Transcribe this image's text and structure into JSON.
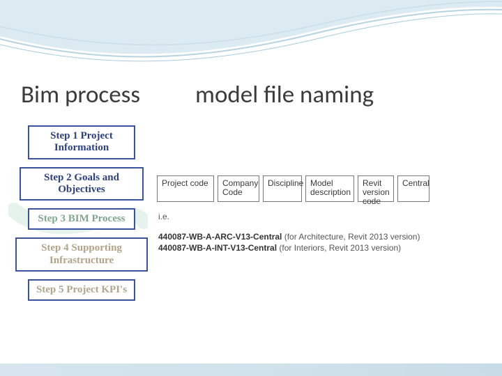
{
  "title_left": "Bim process",
  "title_right": "model file naming",
  "steps": [
    {
      "label": "Step 1 Project Information"
    },
    {
      "label": "Step 2 Goals and Objectives"
    },
    {
      "label": "Step 3 BIM Process"
    },
    {
      "label": "Step 4 Supporting Infrastructure"
    },
    {
      "label": "Step 5 Project KPI's"
    }
  ],
  "naming_parts": {
    "p0": "Project code",
    "p1": "Company Code",
    "p2": "Discipline",
    "p3": "Model description",
    "p4": "Revit version code",
    "p5": "Central"
  },
  "ie_label": "i.e.",
  "examples": {
    "line1_code": "440087-WB-A-ARC-V13-Central",
    "line1_paren": "(for Architecture, Revit 2013 version)",
    "line2_code": "440087-WB-A-INT-V13-Central",
    "line2_paren": "(for Interiors, Revit 2013 version)"
  }
}
